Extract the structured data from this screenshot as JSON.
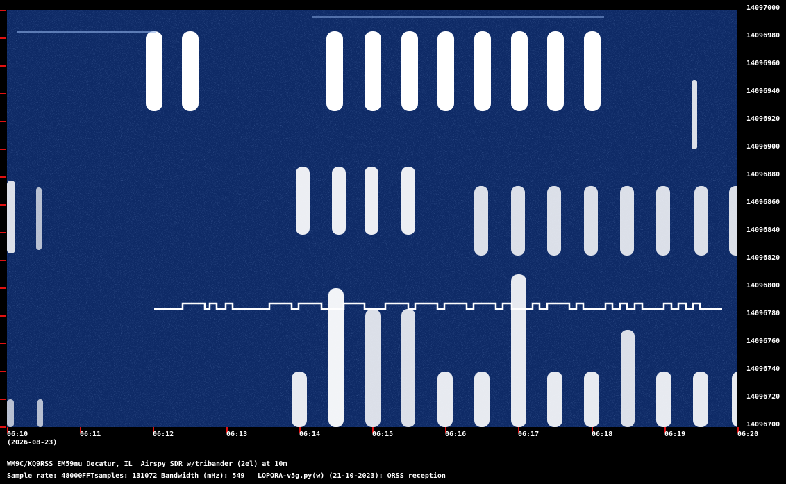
{
  "y_axis_labels": [
    "14097000",
    "14096980",
    "14096960",
    "14096940",
    "14096920",
    "14096900",
    "14096880",
    "14096860",
    "14096840",
    "14096820",
    "14096800",
    "14096780",
    "14096760",
    "14096740",
    "14096720",
    "14096700"
  ],
  "x_axis_labels": [
    "06:10",
    "06:11",
    "06:12",
    "06:13",
    "06:14",
    "06:15",
    "06:16",
    "06:17",
    "06:18",
    "06:19",
    "06:20"
  ],
  "date": "(2026-08-23)",
  "station_line": "WM9C/KQ9RSS EM59nu Decatur, IL  Airspy SDR w/tribander (2el) at 10m",
  "params": {
    "sample_rate": "Sample rate: 48000",
    "fft_samples": "FFTsamples: 131072",
    "bandwidth": "Bandwidth (mHz): 549",
    "software": "LOPORA-v5g.py(w) (21-10-2023): QRSS reception"
  },
  "colors": {
    "background": "#0e2a66",
    "signal": "#ffffff",
    "tick": "#e01010"
  }
}
